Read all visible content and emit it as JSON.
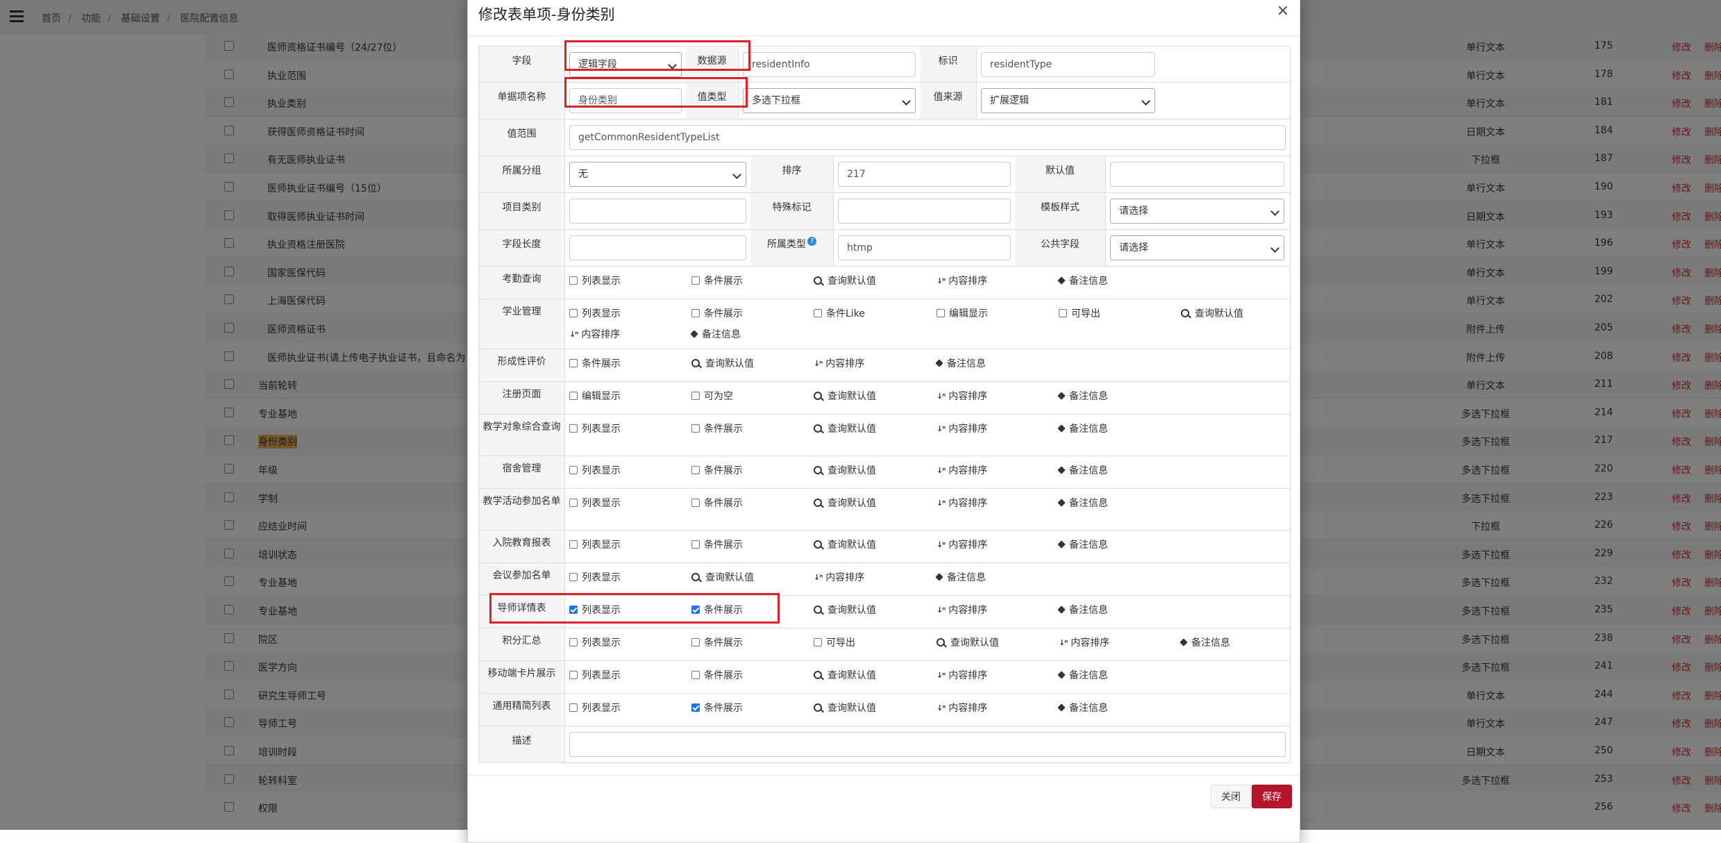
{
  "breadcrumb": [
    "首页",
    "功能",
    "基础设置",
    "医院配置信息"
  ],
  "background_rows": [
    {
      "name": "医师资格证书编号（24/27位）",
      "indent": true,
      "type": "单行文本",
      "sort": "175"
    },
    {
      "name": "执业范围",
      "indent": true,
      "type": "单行文本",
      "sort": "178"
    },
    {
      "name": "执业类别",
      "indent": true,
      "type": "单行文本",
      "sort": "181"
    },
    {
      "name": "获得医师资格证书时间",
      "indent": true,
      "type": "日期文本",
      "sort": "184"
    },
    {
      "name": "有无医师执业证书",
      "indent": true,
      "type": "下拉框",
      "sort": "187"
    },
    {
      "name": "医师执业证书编号（15位）",
      "indent": true,
      "type": "单行文本",
      "sort": "190"
    },
    {
      "name": "取得医师执业证书时间",
      "indent": true,
      "type": "日期文本",
      "sort": "193"
    },
    {
      "name": "执业资格注册医院",
      "indent": true,
      "type": "单行文本",
      "sort": "196"
    },
    {
      "name": "国家医保代码",
      "indent": true,
      "type": "单行文本",
      "sort": "199"
    },
    {
      "name": "上海医保代码",
      "indent": true,
      "type": "单行文本",
      "sort": "202"
    },
    {
      "name": "医师资格证书",
      "indent": true,
      "type": "附件上传",
      "sort": "205"
    },
    {
      "name": "医师执业证书(请上传电子执业证书，且命名为",
      "indent": true,
      "type": "附件上传",
      "sort": "208"
    },
    {
      "name": "当前轮转",
      "indent": false,
      "type": "单行文本",
      "sort": "211"
    },
    {
      "name": "专业基地",
      "indent": false,
      "type": "多选下拉框",
      "sort": "214"
    },
    {
      "name": "身份类别",
      "indent": false,
      "type": "多选下拉框",
      "sort": "217",
      "highlight": true
    },
    {
      "name": "年级",
      "indent": false,
      "type": "多选下拉框",
      "sort": "220"
    },
    {
      "name": "学制",
      "indent": false,
      "type": "多选下拉框",
      "sort": "223"
    },
    {
      "name": "应结业时间",
      "indent": false,
      "type": "下拉框",
      "sort": "226"
    },
    {
      "name": "培训状态",
      "indent": false,
      "type": "多选下拉框",
      "sort": "229"
    },
    {
      "name": "专业基地",
      "indent": false,
      "type": "多选下拉框",
      "sort": "232"
    },
    {
      "name": "专业基地",
      "indent": false,
      "type": "多选下拉框",
      "sort": "235"
    },
    {
      "name": "院区",
      "indent": false,
      "type": "多选下拉框",
      "sort": "238"
    },
    {
      "name": "医学方向",
      "indent": false,
      "type": "多选下拉框",
      "sort": "241"
    },
    {
      "name": "研究生导师工号",
      "indent": false,
      "type": "单行文本",
      "sort": "244"
    },
    {
      "name": "导师工号",
      "indent": false,
      "type": "单行文本",
      "sort": "247"
    },
    {
      "name": "培训时段",
      "indent": false,
      "type": "日期文本",
      "sort": "250"
    },
    {
      "name": "轮转科室",
      "indent": false,
      "type": "多选下拉框",
      "sort": "253"
    },
    {
      "name": "权限",
      "indent": false,
      "type": "",
      "sort": "256"
    }
  ],
  "row_actions": {
    "edit": "修改",
    "delete": "删除"
  },
  "modal": {
    "title": "修改表单项-身份类别",
    "close_icon": "×",
    "fields": {
      "field_label": "字段",
      "field_value": "逻辑字段",
      "datasource_label": "数据源",
      "datasource_value": "residentInfo",
      "id_label": "标识",
      "id_value": "residentType",
      "itemname_label": "单据项名称",
      "itemname_value": "身份类别",
      "valuetype_label": "值类型",
      "valuetype_value": "多选下拉框",
      "valuesource_label": "值来源",
      "valuesource_value": "扩展逻辑",
      "range_label": "值范围",
      "range_value": "getCommonResidentTypeList",
      "group_label": "所属分组",
      "group_value": "无",
      "order_label": "排序",
      "order_value": "217",
      "default_label": "默认值",
      "default_value": "",
      "category_label": "项目类别",
      "category_value": "",
      "special_label": "特殊标记",
      "special_value": "",
      "template_label": "模板样式",
      "template_value": "请选择",
      "length_label": "字段长度",
      "length_value": "",
      "belongtype_label": "所属类型",
      "belongtype_value": "htmp",
      "public_label": "公共字段",
      "public_value": "请选择",
      "desc_label": "描述",
      "desc_value": ""
    },
    "modules": [
      {
        "label": "考勤查询",
        "options": [
          {
            "kind": "checkbox",
            "label": "列表显示",
            "checked": false
          },
          {
            "kind": "checkbox",
            "label": "条件展示",
            "checked": false
          },
          {
            "kind": "search",
            "label": "查询默认值"
          },
          {
            "kind": "sort",
            "label": "内容排序"
          },
          {
            "kind": "tag",
            "label": "备注信息"
          }
        ]
      },
      {
        "label": "学业管理",
        "options": [
          {
            "kind": "checkbox",
            "label": "列表显示",
            "checked": false
          },
          {
            "kind": "checkbox",
            "label": "条件展示",
            "checked": false
          },
          {
            "kind": "checkbox",
            "label": "条件Like",
            "checked": false
          },
          {
            "kind": "checkbox",
            "label": "编辑显示",
            "checked": false
          },
          {
            "kind": "checkbox",
            "label": "可导出",
            "checked": false
          },
          {
            "kind": "search",
            "label": "查询默认值"
          },
          {
            "kind": "sort",
            "label": "内容排序"
          },
          {
            "kind": "tag",
            "label": "备注信息"
          }
        ]
      },
      {
        "label": "形成性评价",
        "options": [
          {
            "kind": "checkbox",
            "label": "条件展示",
            "checked": false
          },
          {
            "kind": "search",
            "label": "查询默认值"
          },
          {
            "kind": "sort",
            "label": "内容排序"
          },
          {
            "kind": "tag",
            "label": "备注信息"
          }
        ]
      },
      {
        "label": "注册页面",
        "options": [
          {
            "kind": "checkbox",
            "label": "编辑显示",
            "checked": false
          },
          {
            "kind": "checkbox",
            "label": "可为空",
            "checked": false
          },
          {
            "kind": "search",
            "label": "查询默认值"
          },
          {
            "kind": "sort",
            "label": "内容排序"
          },
          {
            "kind": "tag",
            "label": "备注信息"
          }
        ]
      },
      {
        "label": "教学对象综合查询",
        "options": [
          {
            "kind": "checkbox",
            "label": "列表显示",
            "checked": false
          },
          {
            "kind": "checkbox",
            "label": "条件展示",
            "checked": false
          },
          {
            "kind": "search",
            "label": "查询默认值"
          },
          {
            "kind": "sort",
            "label": "内容排序"
          },
          {
            "kind": "tag",
            "label": "备注信息"
          }
        ]
      },
      {
        "label": "宿舍管理",
        "options": [
          {
            "kind": "checkbox",
            "label": "列表显示",
            "checked": false
          },
          {
            "kind": "checkbox",
            "label": "条件展示",
            "checked": false
          },
          {
            "kind": "search",
            "label": "查询默认值"
          },
          {
            "kind": "sort",
            "label": "内容排序"
          },
          {
            "kind": "tag",
            "label": "备注信息"
          }
        ]
      },
      {
        "label": "教学活动参加名单",
        "options": [
          {
            "kind": "checkbox",
            "label": "列表显示",
            "checked": false
          },
          {
            "kind": "checkbox",
            "label": "条件展示",
            "checked": false
          },
          {
            "kind": "search",
            "label": "查询默认值"
          },
          {
            "kind": "sort",
            "label": "内容排序"
          },
          {
            "kind": "tag",
            "label": "备注信息"
          }
        ]
      },
      {
        "label": "入院教育报表",
        "options": [
          {
            "kind": "checkbox",
            "label": "列表显示",
            "checked": false
          },
          {
            "kind": "checkbox",
            "label": "条件展示",
            "checked": false
          },
          {
            "kind": "search",
            "label": "查询默认值"
          },
          {
            "kind": "sort",
            "label": "内容排序"
          },
          {
            "kind": "tag",
            "label": "备注信息"
          }
        ]
      },
      {
        "label": "会议参加名单",
        "options": [
          {
            "kind": "checkbox",
            "label": "列表显示",
            "checked": false
          },
          {
            "kind": "search",
            "label": "查询默认值"
          },
          {
            "kind": "sort",
            "label": "内容排序"
          },
          {
            "kind": "tag",
            "label": "备注信息"
          }
        ]
      },
      {
        "label": "导师详情表",
        "options": [
          {
            "kind": "checkbox",
            "label": "列表显示",
            "checked": true
          },
          {
            "kind": "checkbox",
            "label": "条件展示",
            "checked": true
          },
          {
            "kind": "search",
            "label": "查询默认值"
          },
          {
            "kind": "sort",
            "label": "内容排序"
          },
          {
            "kind": "tag",
            "label": "备注信息"
          }
        ]
      },
      {
        "label": "积分汇总",
        "options": [
          {
            "kind": "checkbox",
            "label": "列表显示",
            "checked": false
          },
          {
            "kind": "checkbox",
            "label": "条件展示",
            "checked": false
          },
          {
            "kind": "checkbox",
            "label": "可导出",
            "checked": false
          },
          {
            "kind": "search",
            "label": "查询默认值"
          },
          {
            "kind": "sort",
            "label": "内容排序"
          },
          {
            "kind": "tag",
            "label": "备注信息"
          }
        ]
      },
      {
        "label": "移动端卡片展示",
        "options": [
          {
            "kind": "checkbox",
            "label": "列表显示",
            "checked": false
          },
          {
            "kind": "checkbox",
            "label": "条件展示",
            "checked": false
          },
          {
            "kind": "search",
            "label": "查询默认值"
          },
          {
            "kind": "sort",
            "label": "内容排序"
          },
          {
            "kind": "tag",
            "label": "备注信息"
          }
        ]
      },
      {
        "label": "通用精简列表",
        "options": [
          {
            "kind": "checkbox",
            "label": "列表显示",
            "checked": false
          },
          {
            "kind": "checkbox",
            "label": "条件展示",
            "checked": true
          },
          {
            "kind": "search",
            "label": "查询默认值"
          },
          {
            "kind": "sort",
            "label": "内容排序"
          },
          {
            "kind": "tag",
            "label": "备注信息"
          }
        ]
      }
    ],
    "buttons": {
      "close": "关闭",
      "save": "保存"
    }
  }
}
